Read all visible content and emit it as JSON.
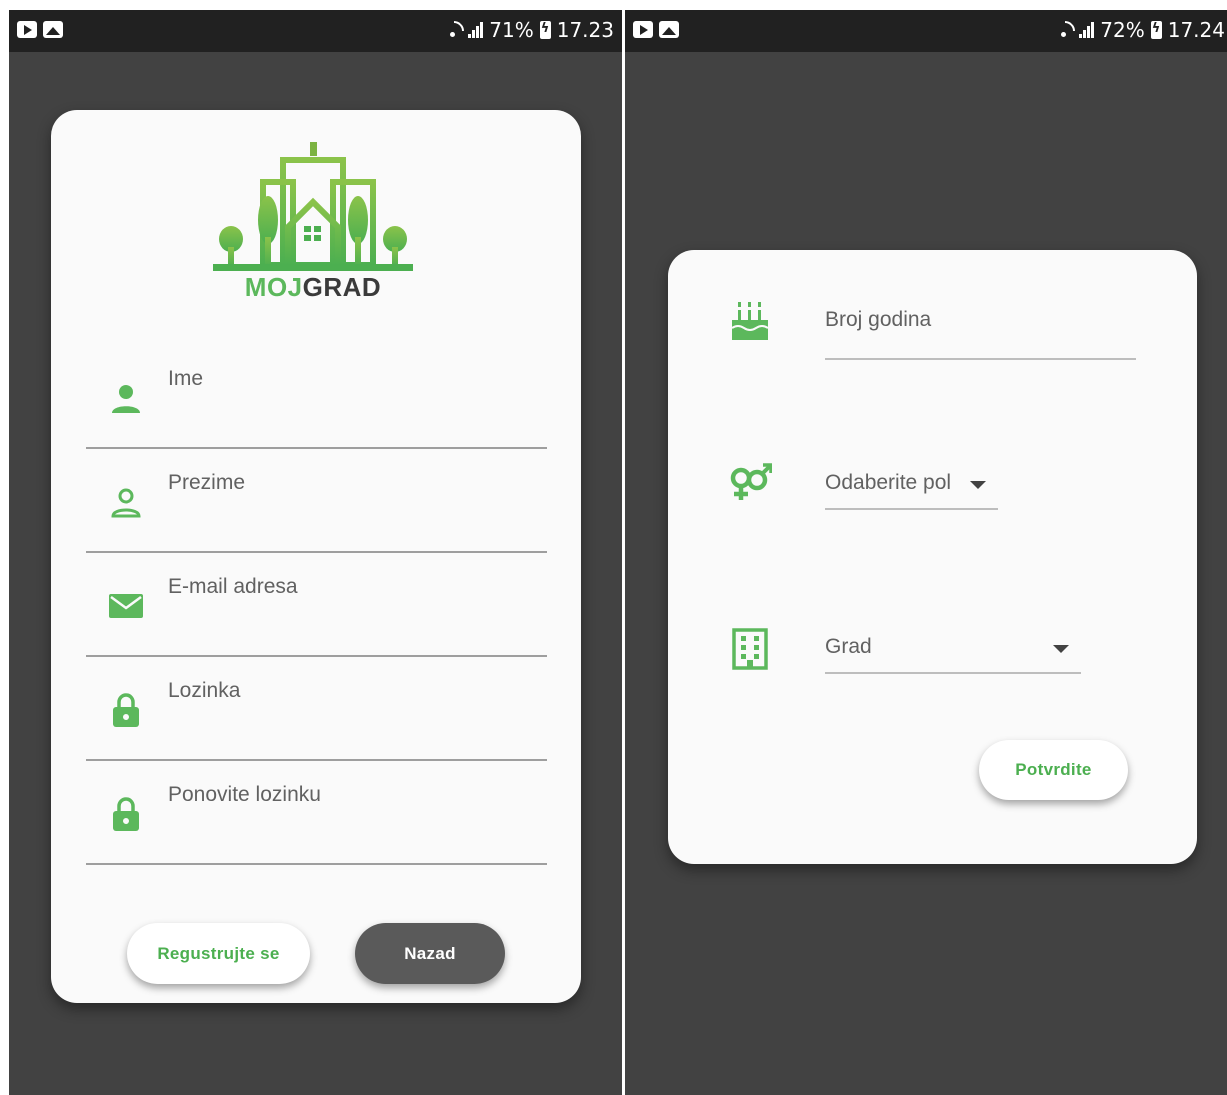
{
  "screens": [
    {
      "status": {
        "battery": "71%",
        "time": "17.23"
      },
      "logo": {
        "text_part1": "MOJ",
        "text_part2": "GRAD"
      },
      "fields": [
        {
          "label": "Ime",
          "icon": "person-icon"
        },
        {
          "label": "Prezime",
          "icon": "person-outline-icon"
        },
        {
          "label": "E-mail adresa",
          "icon": "email-icon"
        },
        {
          "label": "Lozinka",
          "icon": "lock-icon"
        },
        {
          "label": "Ponovite lozinku",
          "icon": "lock-icon"
        }
      ],
      "buttons": {
        "register": "Regustrujte se",
        "back": "Nazad"
      }
    },
    {
      "status": {
        "battery": "72%",
        "time": "17.24"
      },
      "fields": {
        "age": {
          "label": "Broj godina",
          "icon": "cake-icon"
        },
        "gender": {
          "label": "Odaberite pol",
          "icon": "gender-icon"
        },
        "city": {
          "label": "Grad",
          "icon": "building-icon"
        }
      },
      "buttons": {
        "confirm": "Potvrdite"
      }
    }
  ],
  "colors": {
    "accent": "#5cb85c",
    "background": "#424242",
    "card": "#fafafa",
    "dark_button": "#5a5a5a"
  }
}
